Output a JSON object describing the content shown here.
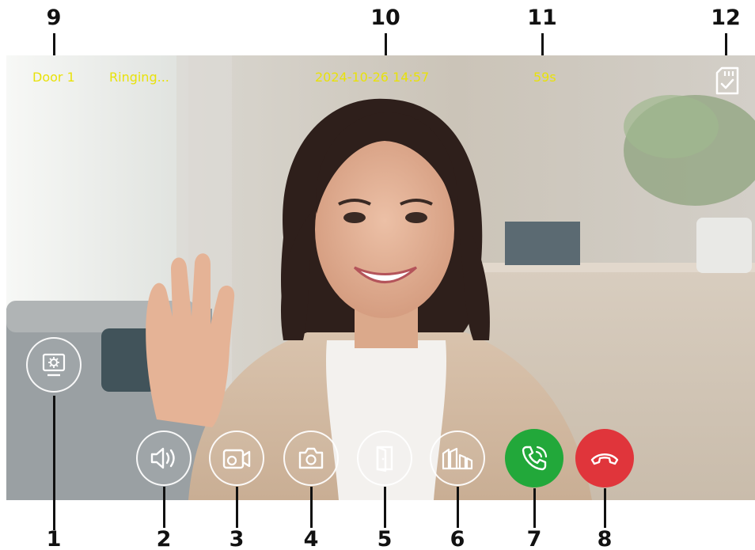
{
  "status_bar": {
    "door": "Door 1",
    "call_state": "Ringing...",
    "datetime": "2024-10-26  14:57",
    "countdown": "59s",
    "sd_card_icon": "sd-card-check-icon"
  },
  "colors": {
    "status_text": "#e8e20a",
    "answer": "#22a83a",
    "hangup": "#e0353b",
    "outline": "#ffffff"
  },
  "controls": [
    {
      "id": "settings",
      "icon": "monitor-settings-icon"
    },
    {
      "id": "speaker",
      "icon": "speaker-volume-icon"
    },
    {
      "id": "record",
      "icon": "video-record-icon"
    },
    {
      "id": "snapshot",
      "icon": "camera-icon"
    },
    {
      "id": "unlock-door",
      "icon": "door-open-icon"
    },
    {
      "id": "unlock-gate",
      "icon": "gate-open-icon"
    },
    {
      "id": "answer",
      "icon": "phone-answer-icon"
    },
    {
      "id": "hangup",
      "icon": "phone-hangup-icon"
    }
  ],
  "callouts": {
    "c1": "1",
    "c2": "2",
    "c3": "3",
    "c4": "4",
    "c5": "5",
    "c6": "6",
    "c7": "7",
    "c8": "8",
    "c9": "9",
    "c10": "10",
    "c11": "11",
    "c12": "12"
  }
}
